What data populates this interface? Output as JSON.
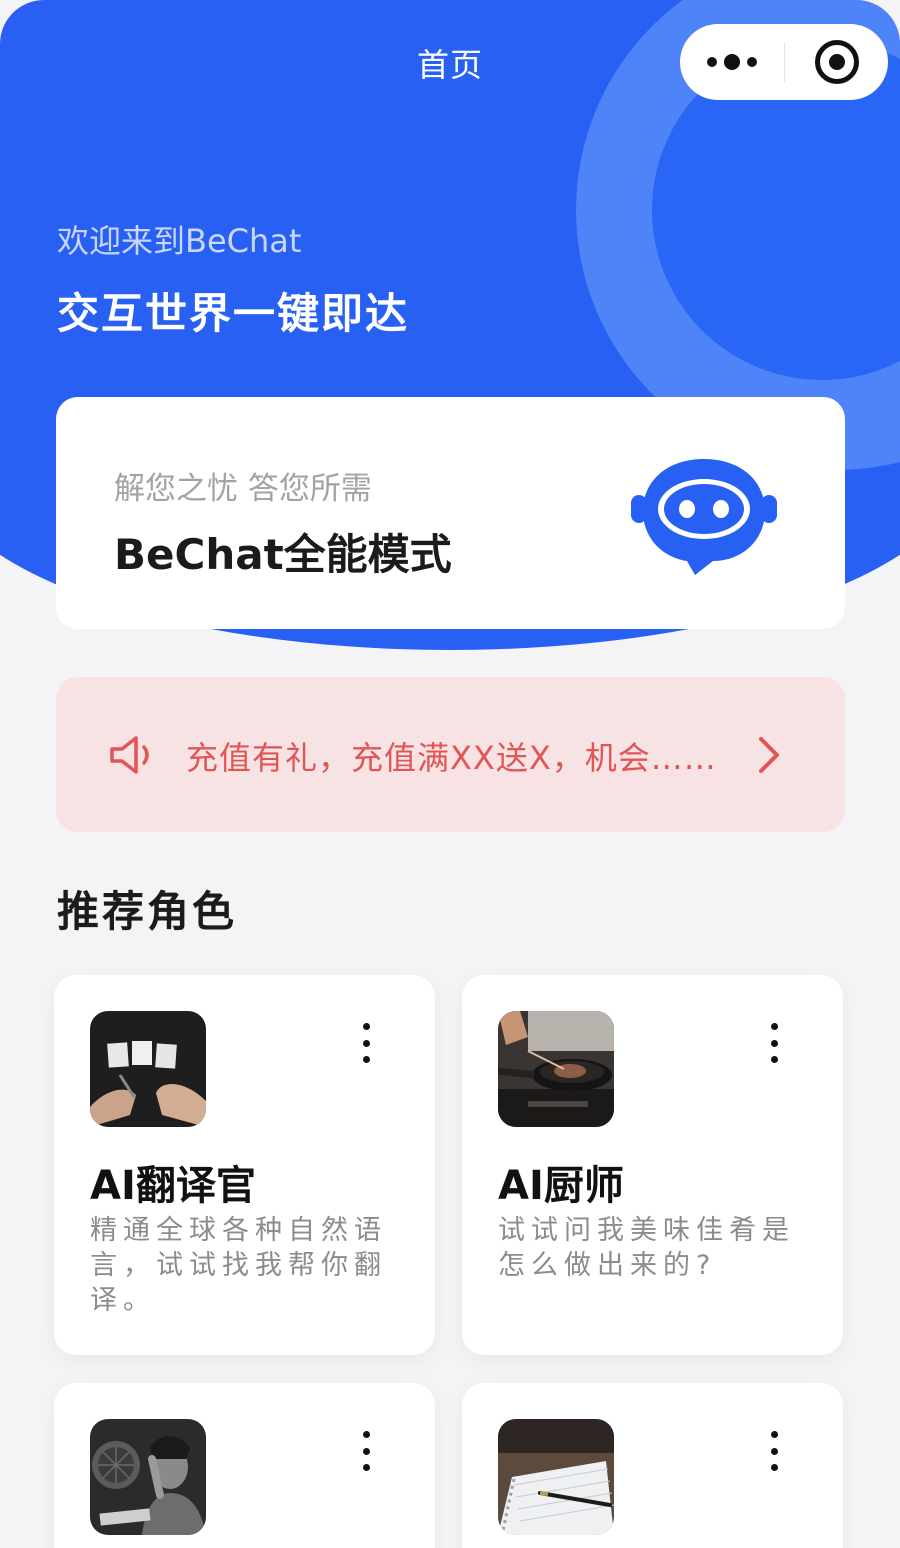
{
  "header": {
    "title": "首页",
    "more_icon": "more-dots-icon",
    "close_icon": "target-circle-icon"
  },
  "hero": {
    "welcome": "欢迎来到BeChat",
    "slogan": "交互世界一键即达"
  },
  "mode_card": {
    "subtitle": "解您之忧 答您所需",
    "title": "BeChat全能模式",
    "icon": "robot-chat-icon"
  },
  "notice": {
    "icon": "speaker-icon",
    "text": "充值有礼，充值满XX送X，机会……",
    "arrow_icon": "chevron-right-icon"
  },
  "section": {
    "title": "推荐角色"
  },
  "roles": [
    {
      "name": "AI翻译官",
      "desc": "精通全球各种自然语言，试试找我帮你翻译。",
      "thumb": "hands-cards-photo"
    },
    {
      "name": "AI厨师",
      "desc": "试试问我美味佳肴是怎么做出来的?",
      "thumb": "chef-cooking-photo"
    },
    {
      "name": "",
      "desc": "",
      "thumb": "thinking-man-photo"
    },
    {
      "name": "",
      "desc": "",
      "thumb": "notebook-pen-photo"
    }
  ],
  "colors": {
    "primary": "#2860f4",
    "notice_bg": "#f7e3e4",
    "notice_text": "#e25555",
    "background": "#f4f4f6"
  }
}
